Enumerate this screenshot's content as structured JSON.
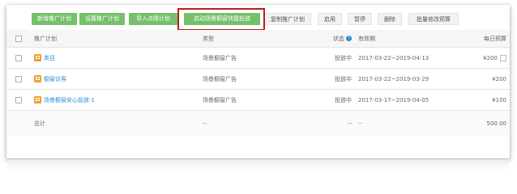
{
  "toolbar": {
    "buttons": [
      {
        "label": "新增推广计划",
        "style": "green"
      },
      {
        "label": "设置推广计划",
        "style": "green"
      },
      {
        "label": "导入点睛计划",
        "style": "green"
      },
      {
        "label": "启动场景橱窗快捷投放",
        "style": "green",
        "highlighted": true
      },
      {
        "label": "复制推广计划",
        "style": "gray"
      },
      {
        "label": "启用",
        "style": "gray"
      },
      {
        "label": "暂停",
        "style": "gray"
      },
      {
        "label": "删除",
        "style": "gray"
      },
      {
        "label": "批量修改预算",
        "style": "gray"
      }
    ]
  },
  "table": {
    "columns": [
      "推广计划",
      "类型",
      "状态",
      "有效期",
      "每日预算"
    ],
    "status_info_icon": "info-icon",
    "rows": [
      {
        "plan": "类目",
        "type": "场景橱窗广告",
        "status": "投放中",
        "period": "2017-03-22~2019-04-13",
        "budget": "¥200"
      },
      {
        "plan": "橱窗访客",
        "type": "场景橱窗广告",
        "status": "投放中",
        "period": "2017-03-22~2019-03-29",
        "budget": "¥200"
      },
      {
        "plan": "场景橱窗安心投放-1",
        "type": "场景橱窗广告",
        "status": "投放中",
        "period": "2017-03-17~2019-04-05",
        "budget": "¥100"
      }
    ],
    "total": {
      "label": "总计",
      "type": "--",
      "status": "--",
      "period": "--",
      "budget": "500.00"
    }
  },
  "colors": {
    "green_button": "#75c06b",
    "highlight_border": "#b4211f",
    "link": "#2b8cd6",
    "plan_icon": "#f0a030"
  }
}
